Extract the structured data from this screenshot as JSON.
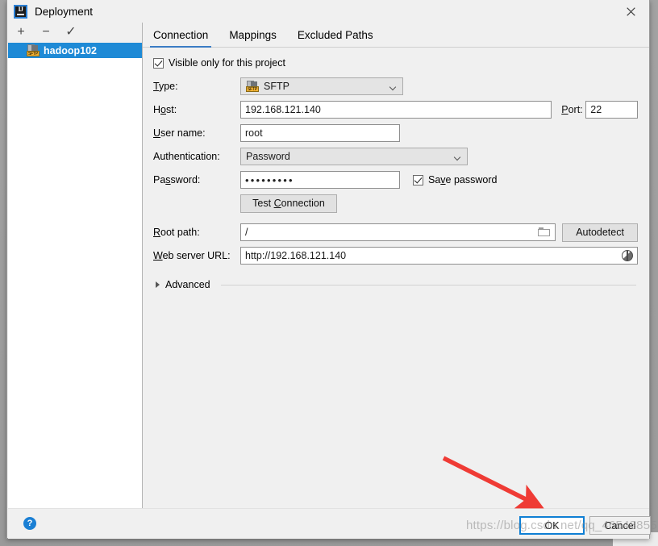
{
  "window": {
    "title": "Deployment",
    "app_icon": "intellij-idea-icon",
    "close_label": "✕"
  },
  "sidebar": {
    "toolbar": [
      {
        "name": "add",
        "glyph": "+"
      },
      {
        "name": "remove",
        "glyph": "−"
      },
      {
        "name": "apply",
        "glyph": "✓"
      }
    ],
    "items": [
      {
        "label": "hadoop102",
        "icon": "sftp-server-icon",
        "selected": true
      }
    ]
  },
  "tabs": [
    {
      "label": "Connection",
      "active": true
    },
    {
      "label": "Mappings",
      "active": false
    },
    {
      "label": "Excluded Paths",
      "active": false
    }
  ],
  "form": {
    "visible_only_checkbox": {
      "label": "Visible only for this project",
      "checked": true
    },
    "type": {
      "label": "Type:",
      "value": "SFTP",
      "icon": "sftp-icon"
    },
    "host": {
      "label": "Host:",
      "value": "192.168.121.140"
    },
    "port": {
      "label": "Port:",
      "value": "22"
    },
    "user_name": {
      "label": "User name:",
      "value": "root"
    },
    "authentication": {
      "label": "Authentication:",
      "value": "Password"
    },
    "password": {
      "label": "Password:",
      "value": "•••••••••"
    },
    "save_password": {
      "label": "Save password",
      "checked": true
    },
    "test_connection_button": "Test Connection",
    "root_path": {
      "label": "Root path:",
      "value": "/",
      "browse_icon": "folder-icon"
    },
    "autodetect_button": "Autodetect",
    "web_server_url": {
      "label": "Web server URL:",
      "value": "http://192.168.121.140",
      "trailing_icon": "globe-icon"
    },
    "advanced": {
      "label": "Advanced",
      "expanded": false,
      "icon": "chevron-right-icon"
    }
  },
  "footer": {
    "help_icon": "help-icon",
    "help_glyph": "?",
    "ok_label": "OK",
    "cancel_label": "Cancel"
  },
  "annotations": {
    "watermark": "https://blog.csdn.net/qq_46548855",
    "arrow_color": "#ef3b35"
  }
}
